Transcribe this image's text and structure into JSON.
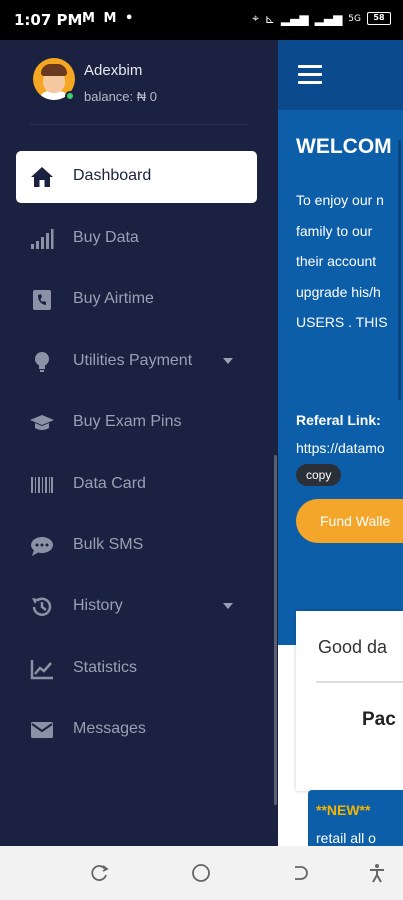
{
  "status_bar": {
    "time": "1:07 PM",
    "left_icons": [
      "gmail-icon",
      "gmail-icon",
      "dot-icon"
    ],
    "right_icons": [
      "location-icon",
      "vowifi-icon",
      "signal-icon",
      "signal-icon",
      "5g-icon"
    ],
    "battery": "58"
  },
  "profile": {
    "name": "Adexbim",
    "balance": "balance: ₦ 0"
  },
  "sidebar": {
    "items": [
      {
        "label": "Dashboard",
        "icon": "home-icon",
        "active": true
      },
      {
        "label": "Buy Data",
        "icon": "signal-bars-icon"
      },
      {
        "label": "Buy Airtime",
        "icon": "phone-icon"
      },
      {
        "label": "Utilities Payment",
        "icon": "lightbulb-icon",
        "dropdown": true
      },
      {
        "label": "Buy Exam Pins",
        "icon": "graduation-cap-icon"
      },
      {
        "label": "Data Card",
        "icon": "barcode-icon"
      },
      {
        "label": "Bulk SMS",
        "icon": "sms-icon"
      },
      {
        "label": "History",
        "icon": "history-icon",
        "dropdown": true
      },
      {
        "label": "Statistics",
        "icon": "chart-line-icon"
      },
      {
        "label": "Messages",
        "icon": "envelope-icon"
      }
    ]
  },
  "main": {
    "welcome": "WELCOM",
    "intro_lines": [
      "To enjoy our n",
      "family to our",
      "their account",
      "upgrade his/h",
      "USERS . THIS"
    ],
    "referal_label": "Referal Link:",
    "referal_link": "https://datamo",
    "copy_label": "copy",
    "fund_wallet_label": "Fund Walle",
    "greeting": "Good da",
    "package_heading": "Pac",
    "new_tag": "**NEW**",
    "new_text": "retail all o"
  },
  "colors": {
    "sidebar_bg": "#1b2140",
    "hero_blue": "#0d5ea8",
    "accent_orange": "#f4a62a",
    "online_green": "#3ad16b"
  }
}
